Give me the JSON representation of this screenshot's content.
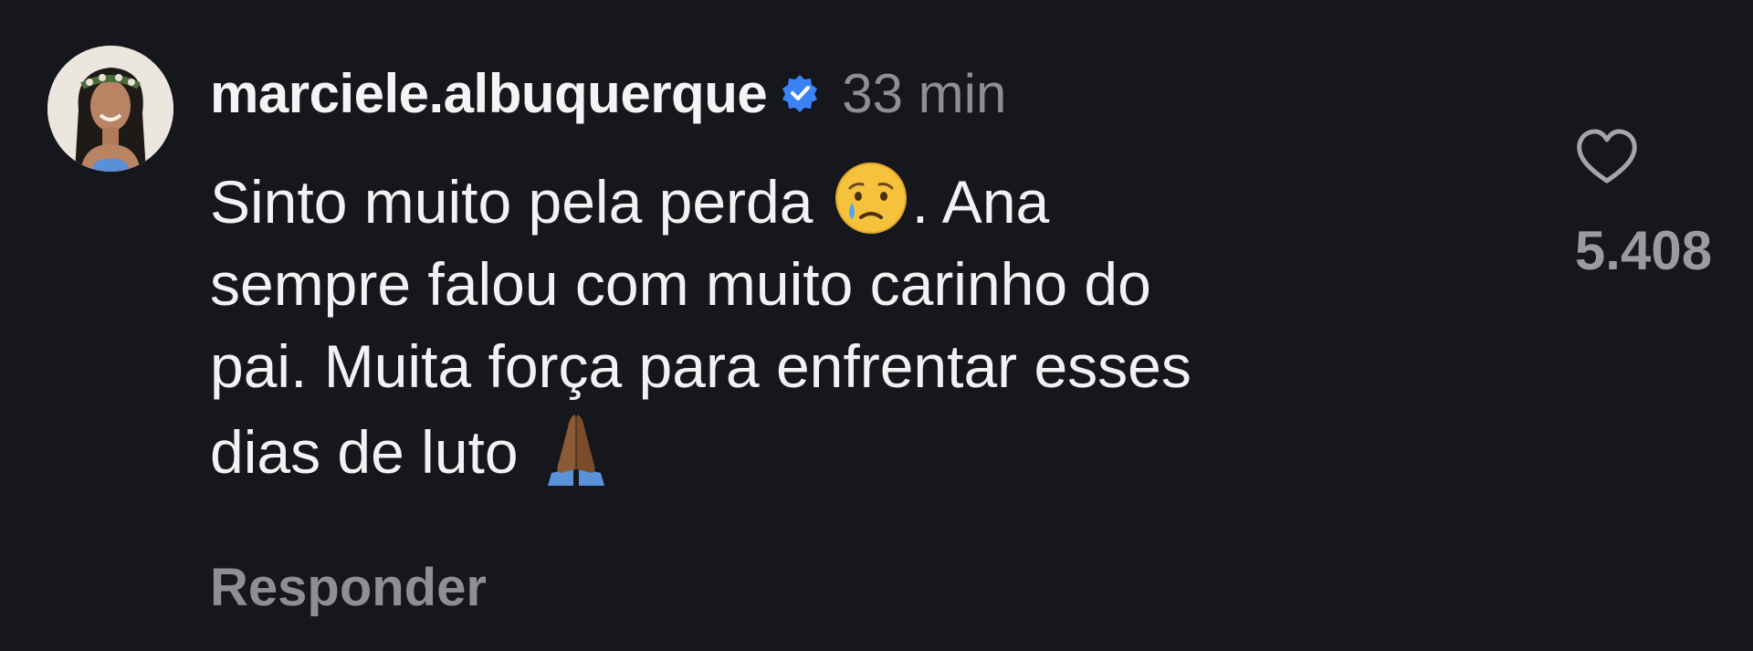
{
  "comment": {
    "username": "marciele.albuquerque",
    "verified": true,
    "time": "33 min",
    "text_lines": [
      {
        "before": "Sinto muito pela perda ",
        "emoji": "crying-face",
        "after": ". Ana"
      },
      {
        "text": "sempre falou com muito carinho do"
      },
      {
        "text": "pai. Muita força para enfrentar esses"
      },
      {
        "before": "dias de luto ",
        "emoji": "folded-hands"
      }
    ],
    "reply_label": "Responder",
    "likes": "5.408",
    "like_icon": "heart-outline-icon",
    "verified_icon": "verified-badge-icon"
  },
  "colors": {
    "background": "#15171c",
    "text": "#f2f2f2",
    "muted": "#8e8f94",
    "verified": "#3b82f6"
  }
}
